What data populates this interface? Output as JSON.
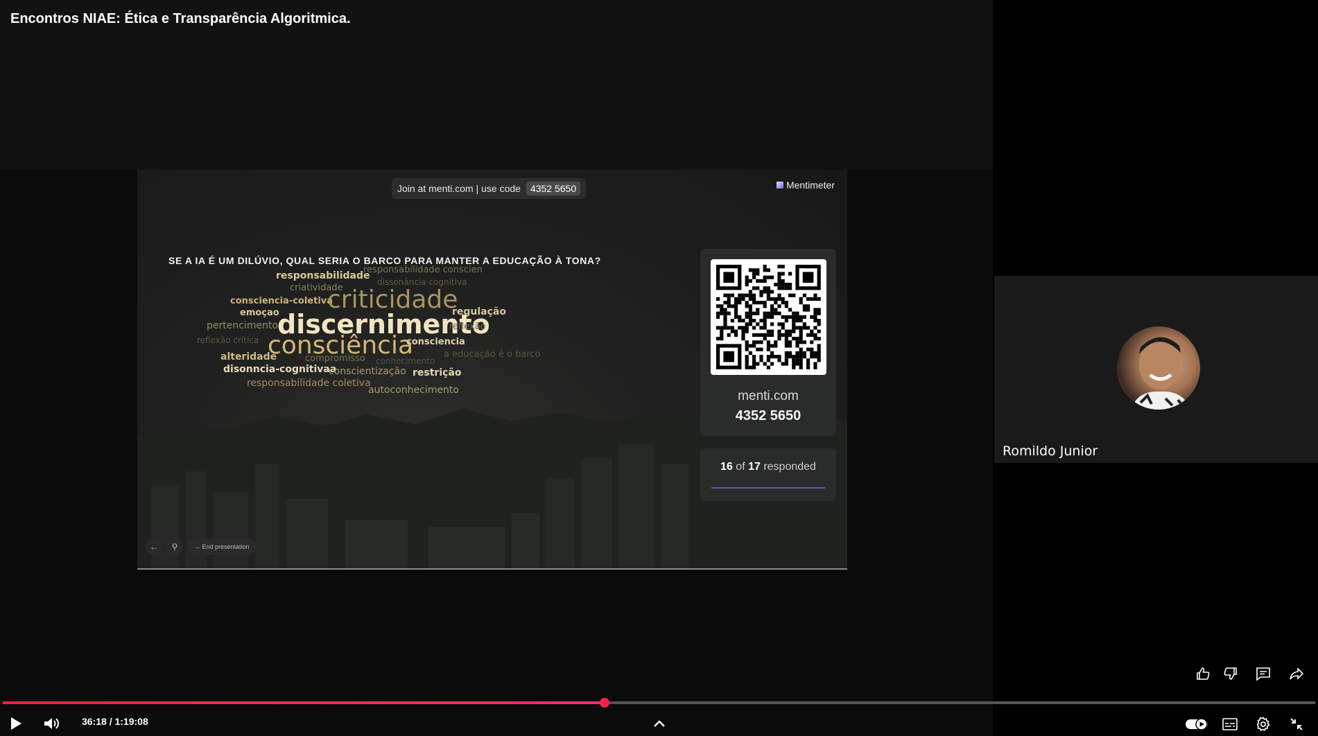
{
  "video": {
    "title": "Encontros NIAE:  Ética e Transparência Algoritmica.",
    "current_time": "36:18",
    "duration": "1:19:08",
    "time_separator": " / ",
    "progress_fraction": 0.4586
  },
  "slide": {
    "join_text": "Join at menti.com | use code",
    "join_code": "4352 5650",
    "logo_text": "Mentimeter",
    "question": "SE A IA É UM DILÚVIO, QUAL SERIA O BARCO PARA MANTER A EDUCAÇÃO À TONA?",
    "qr_url": "menti.com",
    "qr_code": "4352 5650",
    "responded_count": "16",
    "responded_of": " of ",
    "responded_total": "17",
    "responded_suffix": " responded",
    "end_presentation": "End presentation",
    "word_cloud": [
      {
        "text": "responsabilidade",
        "color": "#d9c89a"
      },
      {
        "text": "responsabilidade conscien",
        "color": "#7b7356"
      },
      {
        "text": "criatividade",
        "color": "#8a8264"
      },
      {
        "text": "dissonância cognitiva",
        "color": "#5f5a47"
      },
      {
        "text": "consciencia-coletiva",
        "color": "#cbb27a"
      },
      {
        "text": "criticidade",
        "color": "#a8955e"
      },
      {
        "text": "regulação",
        "color": "#d1c79f"
      },
      {
        "text": "emoçao",
        "color": "#d7c8a0"
      },
      {
        "text": "pertencimento",
        "color": "#9a8e67"
      },
      {
        "text": "discernimento",
        "color": "#f0e4c2"
      },
      {
        "text": "reflexão",
        "color": "#6f6850"
      },
      {
        "text": "reflexão crítica",
        "color": "#5b5645"
      },
      {
        "text": "consciência",
        "color": "#d3b676"
      },
      {
        "text": "consciencia",
        "color": "#e0d2a8"
      },
      {
        "text": "alteridade",
        "color": "#cdbb86"
      },
      {
        "text": "compromisso",
        "color": "#7a7258"
      },
      {
        "text": "conhecimento",
        "color": "#555044"
      },
      {
        "text": "a educação é o barco",
        "color": "#5a5545"
      },
      {
        "text": "disonncia-cognitivaa",
        "color": "#e6dcbc"
      },
      {
        "text": "conscientização",
        "color": "#a89a70"
      },
      {
        "text": "restrição",
        "color": "#e2d6b0"
      },
      {
        "text": "responsabilidade coletiva",
        "color": "#9c8f66"
      },
      {
        "text": "autoconhecimento",
        "color": "#a99b70"
      }
    ]
  },
  "participant": {
    "name": "Romildo Junior"
  },
  "icons": {
    "play": "play-icon",
    "volume": "volume-icon",
    "chevron": "chevron-up-icon",
    "like": "thumbs-up-icon",
    "dislike": "thumbs-down-icon",
    "comments": "comment-icon",
    "share": "share-icon",
    "autoplay": "autoplay-toggle-icon",
    "captions": "captions-icon",
    "settings": "gear-icon",
    "exit_fullscreen": "exit-fullscreen-icon"
  },
  "colors": {
    "progress": "#ff1f4f",
    "track": "#555555"
  }
}
